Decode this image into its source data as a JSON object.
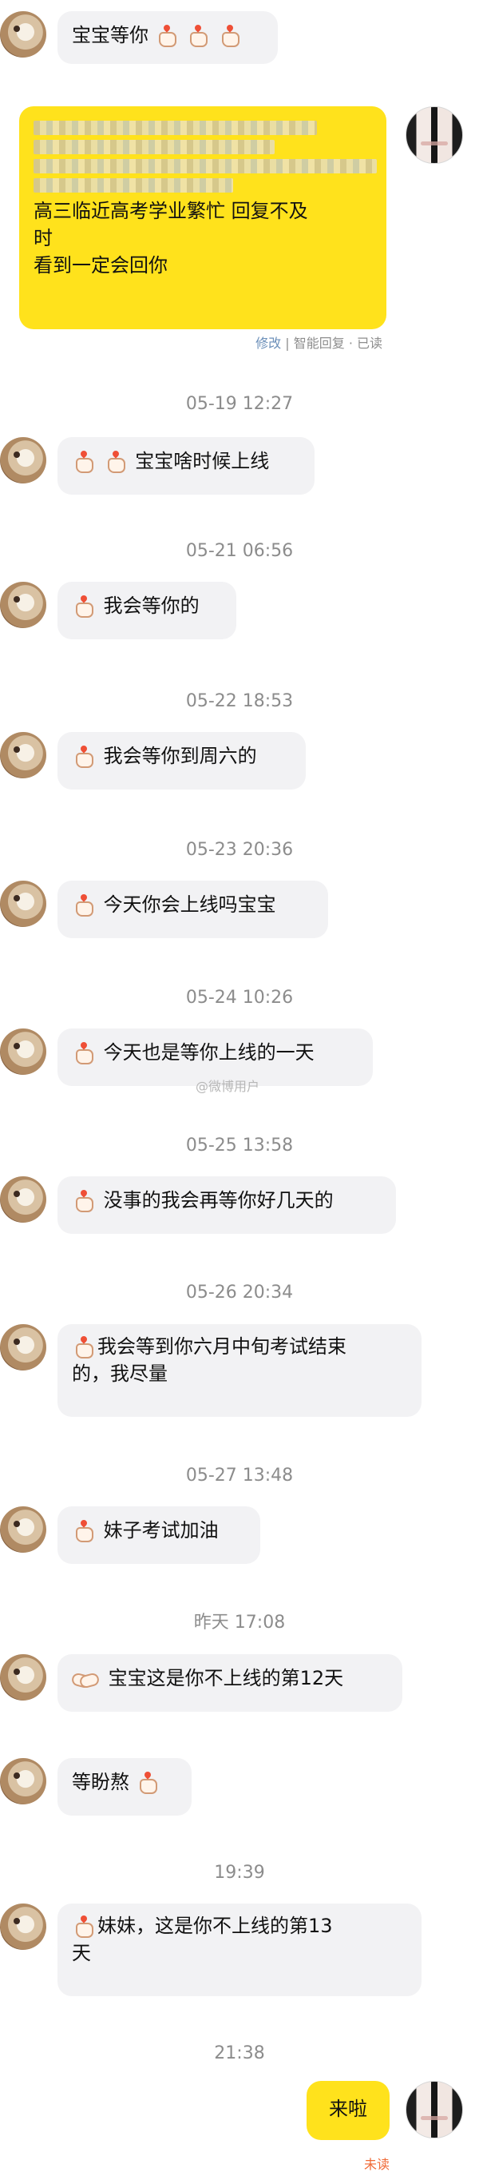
{
  "messages": [
    {
      "text": "宝宝等你"
    },
    {
      "text_lines": [
        "高三临近高考学业繁忙 回复不及",
        "时",
        "看到一定会回你"
      ],
      "meta": [
        "修改",
        "|",
        "智能回复 · 已读"
      ]
    },
    {
      "time": "05-19 12:27",
      "text": "宝宝啥时候上线"
    },
    {
      "time": "05-21 06:56",
      "text": "我会等你的"
    },
    {
      "time": "05-22 18:53",
      "text": "我会等你到周六的"
    },
    {
      "time": "05-23 20:36",
      "text": "今天你会上线吗宝宝"
    },
    {
      "time": "05-24 10:26",
      "text": "今天也是等你上线的一天"
    },
    {
      "time": "05-25 13:58",
      "text": "没事的我会再等你好几天的"
    },
    {
      "time": "05-26 20:34",
      "text_lines": [
        "我会等到你六月中旬考试结束",
        "的，我尽量"
      ]
    },
    {
      "time": "05-27 13:48",
      "text": "妹子考试加油"
    },
    {
      "time": "昨天 17:08",
      "text": "宝宝这是你不上线的第12天"
    },
    {
      "text": "等盼熬"
    },
    {
      "time": "19:39",
      "text_lines": [
        "妹妹，这是你不上线的第13",
        "天"
      ]
    },
    {
      "time": "21:38",
      "text": "来啦",
      "status": "未读"
    }
  ],
  "watermark": "@微博用户"
}
